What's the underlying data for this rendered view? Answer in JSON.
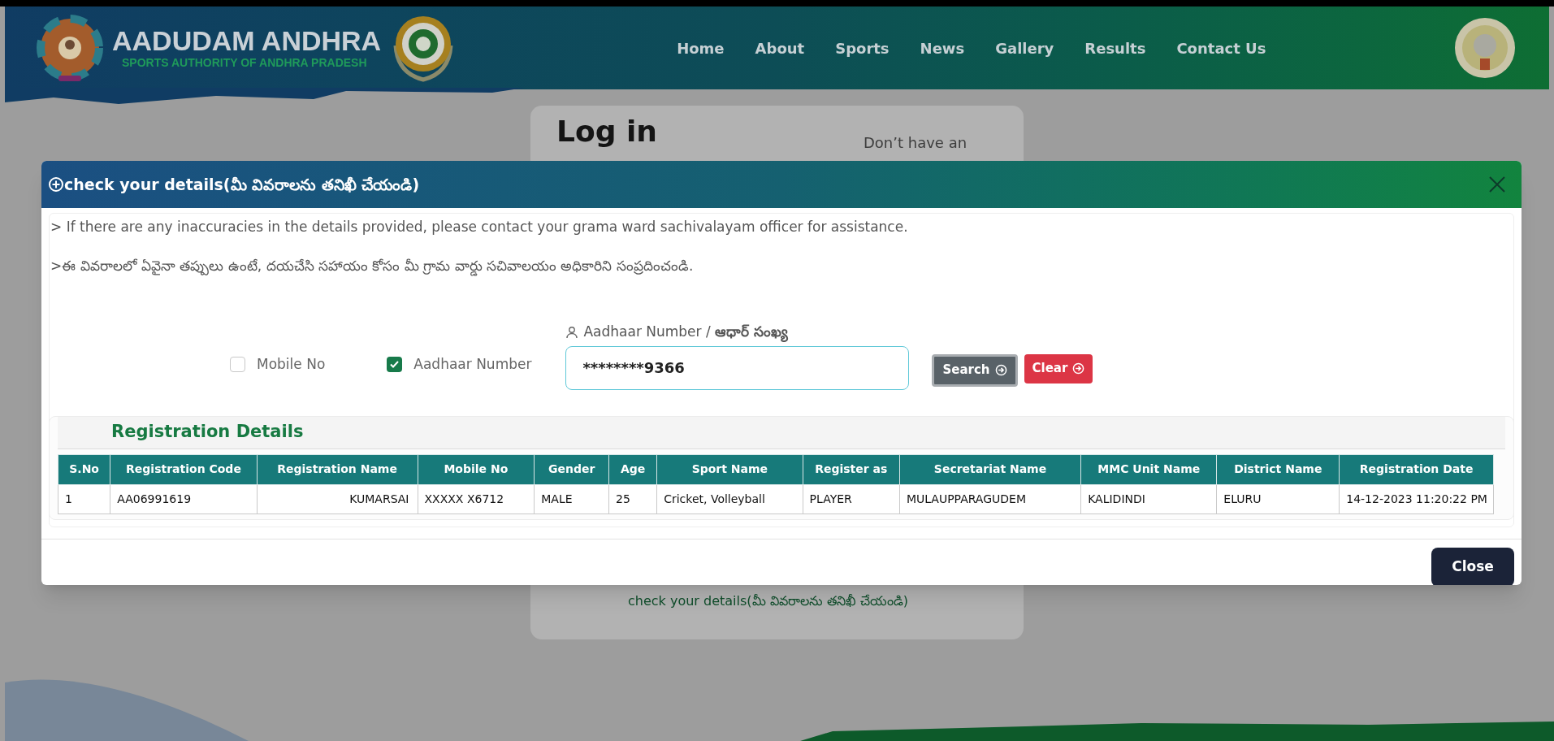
{
  "header": {
    "title": "AADUDAM ANDHRA",
    "subtitle": "SPORTS AUTHORITY OF ANDHRA PRADESH",
    "nav": [
      {
        "label": "Home"
      },
      {
        "label": "About"
      },
      {
        "label": "Sports"
      },
      {
        "label": "News"
      },
      {
        "label": "Gallery"
      },
      {
        "label": "Results"
      },
      {
        "label": "Contact Us"
      }
    ]
  },
  "login_card": {
    "title": "Log in",
    "signup_prompt": "Don’t have an",
    "link": "check your details(మీ వివరాలను తనిఖీ చేయండి)"
  },
  "modal": {
    "title": "check your details(మీ వివరాలను తనిఖీ చేయండి)",
    "notes": [
      "> If there are any inaccuracies in the details provided, please contact your grama ward sachivalayam officer for assistance.",
      ">ఈ వివరాలలో ఏవైనా తప్పులు ఉంటే, దయచేసి సహాయం కోసం మీ గ్రామ వార్డు సచివాలయం అధికారిని సంప్రదించండి."
    ],
    "search": {
      "options": [
        {
          "label": "Mobile No",
          "checked": false
        },
        {
          "label": "Aadhaar Number",
          "checked": true
        }
      ],
      "field_label": "Aadhaar Number / **ఆధార్ సంఖ్య**",
      "value": "********9366",
      "buttons": [
        {
          "label": "Search",
          "kind": "search"
        },
        {
          "label": "Clear",
          "kind": "clear"
        }
      ]
    },
    "section_title": "Registration Details",
    "table": {
      "columns": [
        "S.No",
        "Registration Code",
        "Registration Name",
        "Mobile No",
        "Gender",
        "Age",
        "Sport Name",
        "Register as",
        "Secretariat Name",
        "MMC Unit Name",
        "District Name",
        "Registration Date"
      ],
      "rows": [
        [
          "1",
          "AA06991619",
          "KUMARSAI",
          "XXXXX X6712",
          "MALE",
          "25",
          "Cricket, Volleyball",
          "PLAYER",
          "MULAUPPARAGUDEM",
          "KALIDINDI",
          "ELURU",
          "14-12-2023 11:20:22 PM"
        ]
      ]
    },
    "close_button": "Close"
  }
}
